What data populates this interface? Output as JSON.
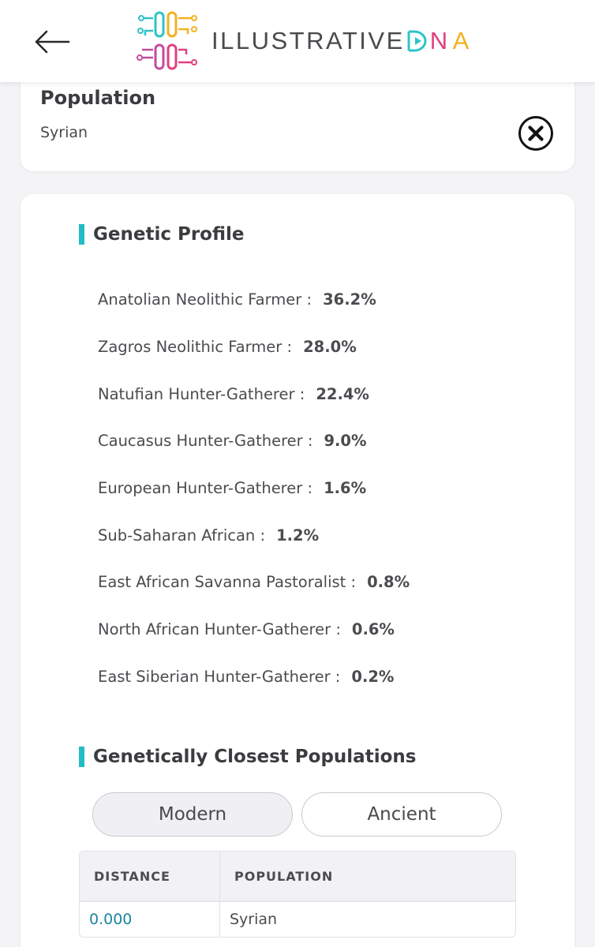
{
  "header": {
    "back_icon": "arrow-left-icon",
    "logo_text_main": "ILLUSTRATIVE",
    "logo_text_d": "D",
    "logo_text_n": "N",
    "logo_text_a": "A"
  },
  "population": {
    "title": "Population",
    "value": "Syrian",
    "close_icon": "close-circle-icon"
  },
  "genetic_profile": {
    "title": "Genetic Profile",
    "items": [
      {
        "label": "Anatolian Neolithic Farmer :",
        "pct": "36.2%"
      },
      {
        "label": "Zagros Neolithic Farmer :",
        "pct": "28.0%"
      },
      {
        "label": "Natufian Hunter-Gatherer :",
        "pct": "22.4%"
      },
      {
        "label": "Caucasus Hunter-Gatherer :",
        "pct": "9.0%"
      },
      {
        "label": "European Hunter-Gatherer :",
        "pct": "1.6%"
      },
      {
        "label": "Sub-Saharan African :",
        "pct": "1.2%"
      },
      {
        "label": "East African Savanna Pastoralist :",
        "pct": "0.8%"
      },
      {
        "label": "North African Hunter-Gatherer :",
        "pct": "0.6%"
      },
      {
        "label": "East Siberian Hunter-Gatherer :",
        "pct": "0.2%"
      }
    ]
  },
  "closest": {
    "title": "Genetically Closest Populations",
    "tabs": [
      "Modern",
      "Ancient"
    ],
    "active_tab": "Modern",
    "columns": [
      "DISTANCE",
      "POPULATION"
    ],
    "rows": [
      {
        "distance": "0.000",
        "population": "Syrian"
      }
    ]
  },
  "colors": {
    "accent": "#22bcc7",
    "distance_text": "#1a86a0"
  }
}
